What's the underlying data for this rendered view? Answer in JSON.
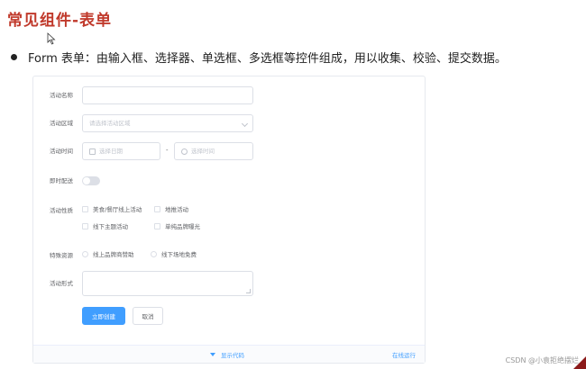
{
  "slide": {
    "title": "常见组件-表单",
    "bullet": "Form 表单：由输入框、选择器、单选框、多选框等控件组成，用以收集、校验、提交数据。"
  },
  "form": {
    "name_label": "活动名称",
    "name_value": "",
    "region_label": "活动区域",
    "region_placeholder": "请选择活动区域",
    "time_label": "活动时间",
    "date_placeholder": "选择日期",
    "time_separator": "-",
    "time_placeholder": "选择时间",
    "delivery_label": "即时配送",
    "delivery_on": false,
    "type_label": "活动性质",
    "type_options": [
      "美食/餐厅线上活动",
      "地推活动",
      "线下主题活动",
      "单纯品牌曝光"
    ],
    "resource_label": "特殊资源",
    "resource_options": [
      "线上品牌商赞助",
      "线下场地免费"
    ],
    "desc_label": "活动形式",
    "desc_value": "",
    "submit_label": "立即创建",
    "cancel_label": "取消"
  },
  "code_bar": {
    "show_code": "显示代码",
    "run_online": "在线运行"
  },
  "watermark": "CSDN @小袁拒绝摆烂",
  "colors": {
    "title": "#c0392b",
    "primary": "#409eff",
    "border": "#dcdfe6",
    "label": "#606266",
    "placeholder": "#c0c4cc"
  },
  "icons": {
    "cursor": "cursor-icon",
    "calendar": "calendar-icon",
    "clock": "clock-icon",
    "chevron": "chevron-down-icon",
    "caret": "caret-down-icon"
  }
}
